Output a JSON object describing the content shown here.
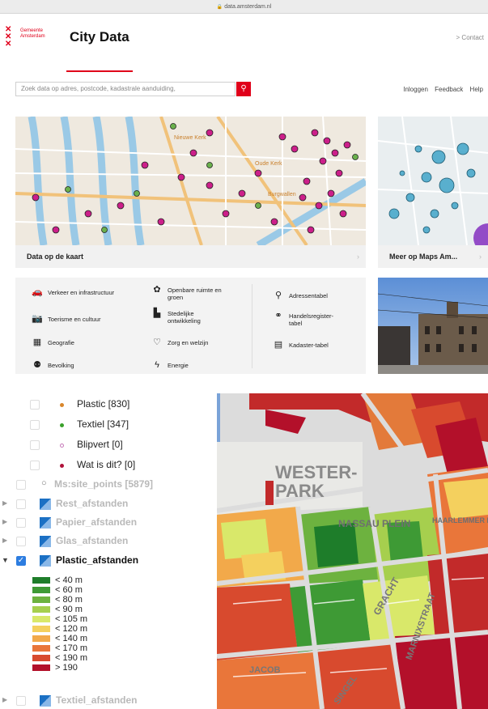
{
  "browser": {
    "url": "data.amsterdam.nl"
  },
  "header": {
    "brand_line1": "Gemeente",
    "brand_line2": "Amsterdam",
    "title": "City Data",
    "contact": "> Contact"
  },
  "search": {
    "placeholder": "Zoek data op adres, postcode, kadastrale aanduiding,"
  },
  "nav": {
    "login": "Inloggen",
    "feedback": "Feedback",
    "help": "Help"
  },
  "cards": {
    "map_label": "Data op de kaart",
    "maps_label": "Meer op Maps Am..."
  },
  "map_labels": {
    "church1": "Nieuwe Kerk",
    "church2": "Oude Kerk",
    "square": "Burgwallen"
  },
  "themes": [
    {
      "icon": "car-icon",
      "label": "Verkeer en infrastructuur"
    },
    {
      "icon": "camera-icon",
      "label": "Toerisme en cultuur"
    },
    {
      "icon": "map-icon",
      "label": "Geografie"
    },
    {
      "icon": "people-icon",
      "label": "Bevolking"
    },
    {
      "icon": "flower-icon",
      "label": "Openbare ruimte en groen"
    },
    {
      "icon": "city-icon",
      "label": "Stedelijke ontwikkeling"
    },
    {
      "icon": "heart-icon",
      "label": "Zorg en welzijn"
    },
    {
      "icon": "lightning-icon",
      "label": "Energie"
    },
    {
      "icon": "pin-icon",
      "label": "Adressentabel"
    },
    {
      "icon": "handshake-icon",
      "label": "Handelsregister-tabel"
    },
    {
      "icon": "building-icon",
      "label": "Kadaster-tabel"
    }
  ],
  "layers": {
    "points": [
      {
        "label": "Plastic [830]",
        "color": "#d9862b"
      },
      {
        "label": "Textiel [347]",
        "color": "#3aa12c"
      },
      {
        "label": "Blipvert [0]",
        "color": "#c678b8"
      },
      {
        "label": "Wat is dit? [0]",
        "color": "#b0123a"
      }
    ],
    "site_points": "Ms:site_points [5879]",
    "rest": "Rest_afstanden",
    "papier": "Papier_afstanden",
    "glas": "Glas_afstanden",
    "plastic": "Plastic_afstanden",
    "textiel": "Textiel_afstanden",
    "legend": [
      {
        "label": "< 40 m",
        "color": "#1e7d2a"
      },
      {
        "label": "< 60 m",
        "color": "#3e9a35"
      },
      {
        "label": "< 80 m",
        "color": "#6db23f"
      },
      {
        "label": "< 90 m",
        "color": "#a6cf4e"
      },
      {
        "label": "< 105 m",
        "color": "#d9e86a"
      },
      {
        "label": "< 120 m",
        "color": "#f4d05e"
      },
      {
        "label": "< 140 m",
        "color": "#f2a94a"
      },
      {
        "label": "< 170 m",
        "color": "#e9763a"
      },
      {
        "label": "< 190 m",
        "color": "#d84a2e"
      },
      {
        "label": "> 190",
        "color": "#b3102a"
      }
    ]
  },
  "map_right": {
    "park1": "WESTER-",
    "park2": "PARK",
    "plein": "NASSAU PLEIN",
    "haarlemmer": "HAARLEMMER PLEIN",
    "gracht": "GRACHT",
    "straat": "MARNIXSTRAAT",
    "jacob": "JACOB",
    "singel": "SINGEL"
  }
}
